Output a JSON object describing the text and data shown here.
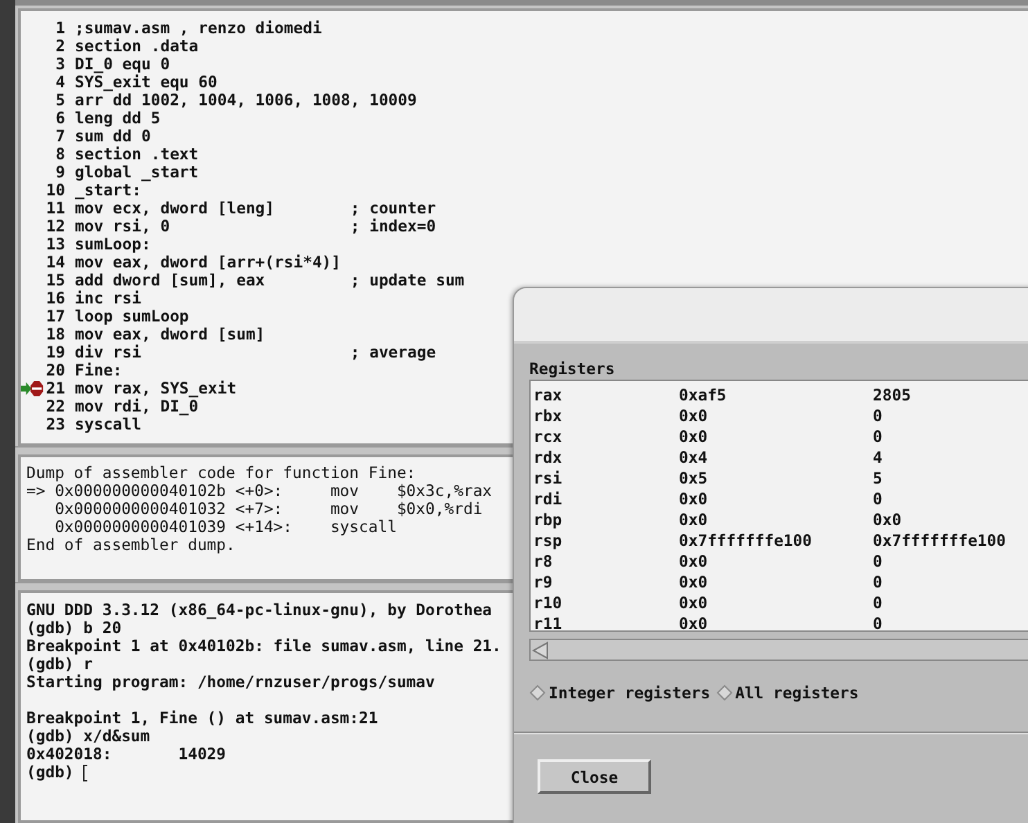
{
  "source": {
    "lines": [
      {
        "num": "1",
        "code": ";sumav.asm , renzo diomedi",
        "breakpoint": false
      },
      {
        "num": "2",
        "code": "section .data",
        "breakpoint": false
      },
      {
        "num": "3",
        "code": "DI_0 equ 0",
        "breakpoint": false
      },
      {
        "num": "4",
        "code": "SYS_exit equ 60",
        "breakpoint": false
      },
      {
        "num": "5",
        "code": "arr dd 1002, 1004, 1006, 1008, 10009",
        "breakpoint": false
      },
      {
        "num": "6",
        "code": "leng dd 5",
        "breakpoint": false
      },
      {
        "num": "7",
        "code": "sum dd 0",
        "breakpoint": false
      },
      {
        "num": "8",
        "code": "section .text",
        "breakpoint": false
      },
      {
        "num": "9",
        "code": "global _start",
        "breakpoint": false
      },
      {
        "num": "10",
        "code": "_start:",
        "breakpoint": false
      },
      {
        "num": "11",
        "code": "mov ecx, dword [leng]        ; counter",
        "breakpoint": false
      },
      {
        "num": "12",
        "code": "mov rsi, 0                   ; index=0",
        "breakpoint": false
      },
      {
        "num": "13",
        "code": "sumLoop:",
        "breakpoint": false
      },
      {
        "num": "14",
        "code": "mov eax, dword [arr+(rsi*4)]",
        "breakpoint": false
      },
      {
        "num": "15",
        "code": "add dword [sum], eax         ; update sum",
        "breakpoint": false
      },
      {
        "num": "16",
        "code": "inc rsi",
        "breakpoint": false
      },
      {
        "num": "17",
        "code": "loop sumLoop",
        "breakpoint": false
      },
      {
        "num": "18",
        "code": "mov eax, dword [sum]",
        "breakpoint": false
      },
      {
        "num": "19",
        "code": "div rsi                      ; average",
        "breakpoint": false
      },
      {
        "num": "20",
        "code": "Fine:",
        "breakpoint": false
      },
      {
        "num": "21",
        "code": "mov rax, SYS_exit",
        "breakpoint": true
      },
      {
        "num": "22",
        "code": "mov rdi, DI_0",
        "breakpoint": false
      },
      {
        "num": "23",
        "code": "syscall",
        "breakpoint": false
      }
    ]
  },
  "assembler": {
    "lines": [
      "Dump of assembler code for function Fine:",
      "=> 0x000000000040102b <+0>:     mov    $0x3c,%rax",
      "   0x0000000000401032 <+7>:     mov    $0x0,%rdi",
      "   0x0000000000401039 <+14>:    syscall",
      "End of assembler dump."
    ]
  },
  "console": {
    "lines": [
      {
        "text": "GNU DDD 3.3.12 (x86_64-pc-linux-gnu), by Dorothea",
        "blank_before": false
      },
      {
        "text": "(gdb) b 20",
        "blank_before": false
      },
      {
        "text": "Breakpoint 1 at 0x40102b: file sumav.asm, line 21.",
        "blank_before": false
      },
      {
        "text": "(gdb) r",
        "blank_before": false
      },
      {
        "text": "Starting program: /home/rnzuser/progs/sumav",
        "blank_before": false
      },
      {
        "text": "Breakpoint 1, Fine () at sumav.asm:21",
        "blank_before": true
      },
      {
        "text": "(gdb) x/d&sum",
        "blank_before": false
      },
      {
        "text": "0x402018:       14029",
        "blank_before": false
      },
      {
        "text": "(gdb)",
        "blank_before": false
      }
    ]
  },
  "registers_dialog": {
    "title": "Registers",
    "rows": [
      {
        "name": "rax",
        "hex": "0xaf5",
        "value": "2805"
      },
      {
        "name": "rbx",
        "hex": "0x0",
        "value": "0"
      },
      {
        "name": "rcx",
        "hex": "0x0",
        "value": "0"
      },
      {
        "name": "rdx",
        "hex": "0x4",
        "value": "4"
      },
      {
        "name": "rsi",
        "hex": "0x5",
        "value": "5"
      },
      {
        "name": "rdi",
        "hex": "0x0",
        "value": "0"
      },
      {
        "name": "rbp",
        "hex": "0x0",
        "value": "0x0"
      },
      {
        "name": "rsp",
        "hex": "0x7fffffffe100",
        "value": "0x7fffffffe100"
      },
      {
        "name": "r8",
        "hex": "0x0",
        "value": "0"
      },
      {
        "name": "r9",
        "hex": "0x0",
        "value": "0"
      },
      {
        "name": "r10",
        "hex": "0x0",
        "value": "0"
      },
      {
        "name": "r11",
        "hex": "0x0",
        "value": "0"
      }
    ],
    "options": [
      {
        "label": "Integer registers",
        "selected": false
      },
      {
        "label": "All registers",
        "selected": false
      }
    ],
    "buttons": [
      "Close"
    ]
  }
}
